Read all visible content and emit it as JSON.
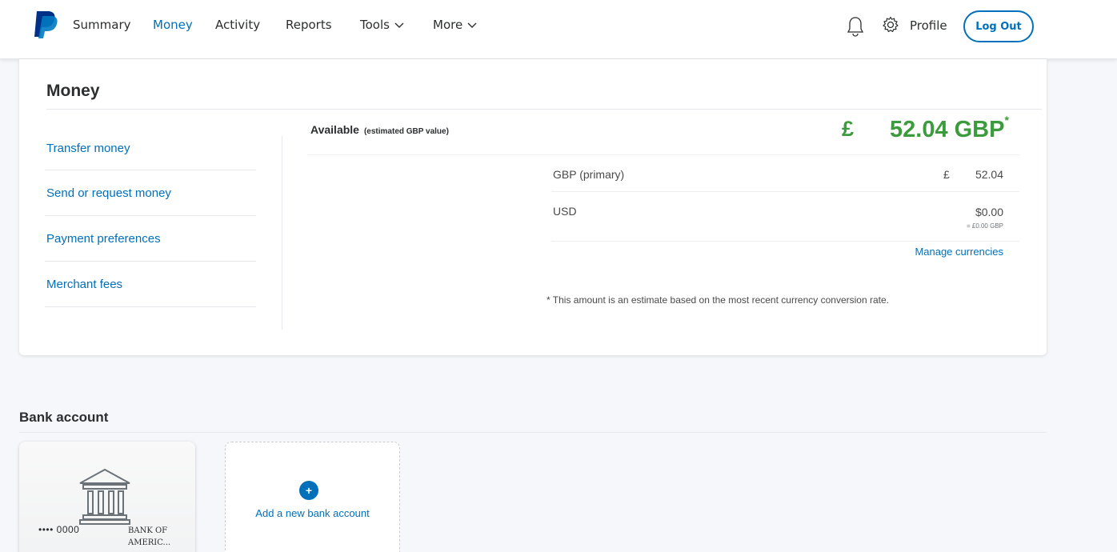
{
  "nav": {
    "logo_icon": "paypal-logo-icon",
    "items": [
      {
        "label": "Summary",
        "active": false
      },
      {
        "label": "Money",
        "active": true
      },
      {
        "label": "Activity",
        "active": false
      },
      {
        "label": "Reports",
        "active": false
      },
      {
        "label": "Tools",
        "active": false,
        "dropdown": true
      },
      {
        "label": "More",
        "active": false,
        "dropdown": true
      }
    ],
    "notification_icon": "bell-icon",
    "settings_icon": "gear-icon",
    "profile_label": "Profile",
    "logout_label": "Log Out"
  },
  "money": {
    "title": "Money",
    "sidebar": [
      {
        "label": "Transfer money"
      },
      {
        "label": "Send or request money"
      },
      {
        "label": "Payment preferences"
      },
      {
        "label": "Merchant fees"
      }
    ],
    "available_label": "Available",
    "available_sub": "(estimated GBP value)",
    "balance_symbol": "£",
    "balance_amount": "52.04 GBP",
    "balance_marker": "*",
    "currencies": [
      {
        "name": "GBP (primary)",
        "symbol": "£",
        "value": "52.04",
        "converted": ""
      },
      {
        "name": "USD",
        "symbol": "",
        "value": "$0.00",
        "converted": "= £0.00 GBP"
      }
    ],
    "manage_label": "Manage currencies",
    "footnote": "* This amount is an estimate based on the most recent currency conversion rate."
  },
  "bank": {
    "heading": "Bank account",
    "accounts": [
      {
        "icon": "bank-building-icon",
        "masked_number": "•••• 0000",
        "name_line1": "BANK OF",
        "name_line2": "AMERIC..."
      }
    ],
    "add_icon": "plus-icon",
    "add_label": "Add a new bank account"
  },
  "colors": {
    "brand_blue": "#0070ba",
    "balance_green": "#3c9b3c",
    "page_bg": "#f5f7fa"
  }
}
